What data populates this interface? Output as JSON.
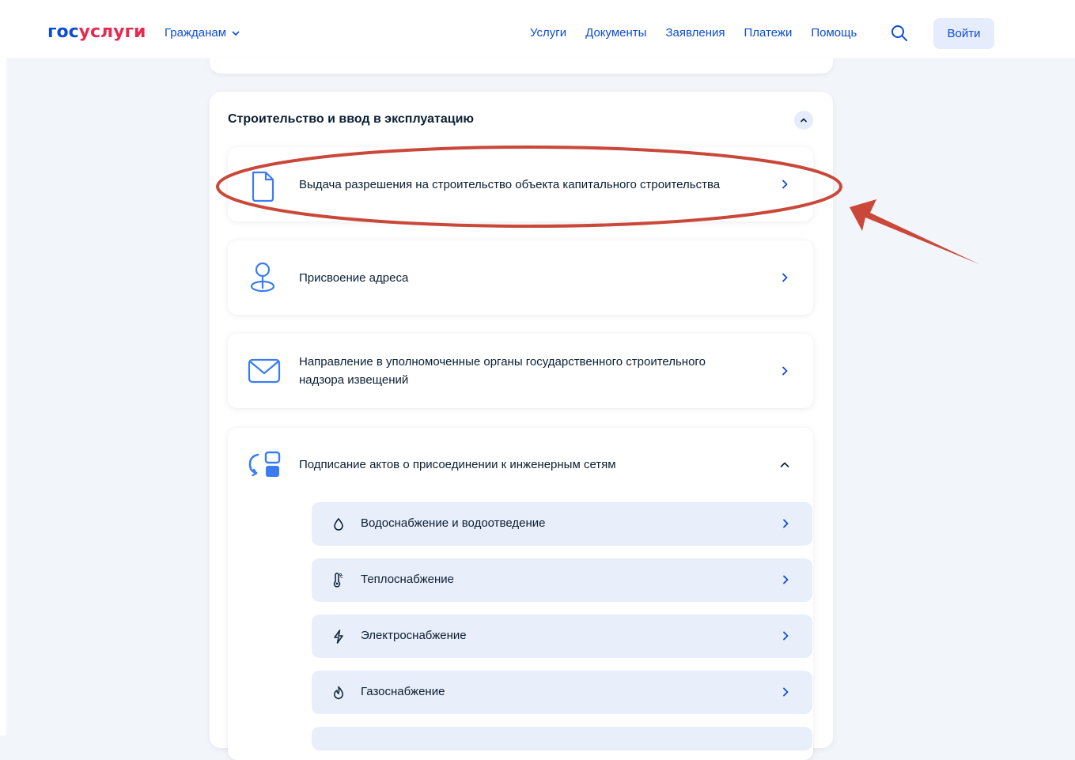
{
  "header": {
    "logo_gos": "гос",
    "logo_uslugi": "услуги",
    "audience": "Гражданам",
    "nav": [
      "Услуги",
      "Документы",
      "Заявления",
      "Платежи",
      "Помощь"
    ],
    "login": "Войти"
  },
  "section": {
    "title": "Строительство и ввод в эксплуатацию",
    "items": [
      {
        "label": "Выдача разрешения на строительство объекта капитального строительства",
        "icon": "document-icon"
      },
      {
        "label": "Присвоение адреса",
        "icon": "location-pin-icon"
      },
      {
        "label": "Направление в уполномоченные органы государственного строительного надзора извещений",
        "icon": "envelope-icon"
      },
      {
        "label": "Подписание актов о присоединении к инженерным сетям",
        "icon": "utility-networks-icon"
      }
    ],
    "subitems": [
      {
        "label": "Водоснабжение и водоотведение",
        "icon": "water-drop-icon"
      },
      {
        "label": "Теплоснабжение",
        "icon": "thermometer-icon"
      },
      {
        "label": "Электроснабжение",
        "icon": "lightning-icon"
      },
      {
        "label": "Газоснабжение",
        "icon": "flame-icon"
      }
    ]
  },
  "colors": {
    "brand_blue": "#0d4cd3",
    "brand_red": "#e52b50",
    "annotation_red": "#c9483a",
    "icon_blue": "#3b7cf0"
  }
}
